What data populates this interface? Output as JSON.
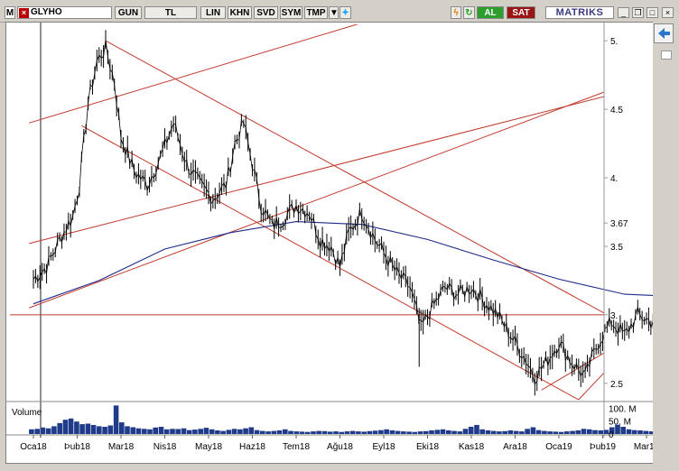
{
  "toolbar": {
    "menu_label": "M",
    "symbol": "GLYHO",
    "buttons": [
      "GUN",
      "TL",
      "LIN",
      "KHN",
      "SVD",
      "SYM",
      "TMP"
    ],
    "buy_label": "AL",
    "sell_label": "SAT",
    "brand": "MATRIKS"
  },
  "chart_data": {
    "type": "line",
    "title": "",
    "y_ticks": [
      "5.",
      "4.5",
      "4.",
      "3.67",
      "3.5",
      "3.",
      "2.5"
    ],
    "y_tick_values": [
      5.0,
      4.5,
      4.0,
      3.67,
      3.5,
      3.0,
      2.5
    ],
    "last_price": 3.67,
    "x_labels": [
      "Oca18",
      "Þub18",
      "Mar18",
      "Nis18",
      "May18",
      "Haz18",
      "Tem18",
      "Ağu18",
      "Eyl18",
      "Eki18",
      "Kas18",
      "Ara18",
      "Oca19",
      "Þub19",
      "Mar19"
    ],
    "price_path": [
      [
        0,
        3.26
      ],
      [
        0.3,
        3.35
      ],
      [
        0.6,
        3.55
      ],
      [
        0.9,
        3.72
      ],
      [
        1.05,
        3.95
      ],
      [
        1.25,
        4.55
      ],
      [
        1.45,
        4.85
      ],
      [
        1.65,
        4.95
      ],
      [
        1.85,
        4.7
      ],
      [
        2.0,
        4.3
      ],
      [
        2.3,
        4.05
      ],
      [
        2.6,
        3.95
      ],
      [
        2.9,
        4.15
      ],
      [
        3.2,
        4.4
      ],
      [
        3.5,
        4.1
      ],
      [
        3.8,
        3.95
      ],
      [
        4.1,
        3.85
      ],
      [
        4.4,
        3.95
      ],
      [
        4.6,
        4.25
      ],
      [
        4.8,
        4.4
      ],
      [
        5.0,
        4.1
      ],
      [
        5.2,
        3.8
      ],
      [
        5.45,
        3.65
      ],
      [
        5.7,
        3.7
      ],
      [
        6.0,
        3.8
      ],
      [
        6.3,
        3.75
      ],
      [
        6.55,
        3.55
      ],
      [
        6.8,
        3.5
      ],
      [
        7.0,
        3.35
      ],
      [
        7.2,
        3.6
      ],
      [
        7.5,
        3.75
      ],
      [
        7.8,
        3.55
      ],
      [
        8.0,
        3.45
      ],
      [
        8.3,
        3.3
      ],
      [
        8.6,
        3.2
      ],
      [
        8.85,
        2.9
      ],
      [
        9.1,
        3.05
      ],
      [
        9.4,
        3.2
      ],
      [
        9.7,
        3.15
      ],
      [
        10.0,
        3.2
      ],
      [
        10.3,
        3.1
      ],
      [
        10.6,
        3.0
      ],
      [
        10.9,
        2.85
      ],
      [
        11.2,
        2.7
      ],
      [
        11.45,
        2.55
      ],
      [
        11.7,
        2.65
      ],
      [
        12.0,
        2.8
      ],
      [
        12.3,
        2.65
      ],
      [
        12.6,
        2.55
      ],
      [
        12.9,
        2.8
      ],
      [
        13.2,
        2.95
      ],
      [
        13.5,
        2.85
      ],
      [
        13.8,
        3.0
      ],
      [
        14.1,
        2.95
      ],
      [
        14.4,
        3.05
      ],
      [
        14.7,
        3.0
      ],
      [
        15.0,
        3.15
      ],
      [
        15.3,
        3.35
      ],
      [
        15.6,
        3.5
      ],
      [
        15.9,
        3.55
      ],
      [
        16.2,
        3.7
      ],
      [
        16.5,
        3.8
      ],
      [
        16.8,
        3.75
      ],
      [
        17.0,
        3.82
      ],
      [
        17.2,
        3.7
      ],
      [
        17.4,
        3.67
      ]
    ],
    "moving_average": [
      [
        0,
        3.08
      ],
      [
        1.5,
        3.25
      ],
      [
        3,
        3.48
      ],
      [
        4.5,
        3.6
      ],
      [
        6,
        3.68
      ],
      [
        7.5,
        3.66
      ],
      [
        9,
        3.55
      ],
      [
        10.5,
        3.4
      ],
      [
        12,
        3.26
      ],
      [
        13.5,
        3.15
      ],
      [
        15,
        3.13
      ],
      [
        16.5,
        3.2
      ],
      [
        17.4,
        3.28
      ]
    ],
    "trend_lines": [
      [
        [
          -0.1,
          4.4
        ],
        [
          7.7,
          5.15
        ]
      ],
      [
        [
          -0.1,
          3.52
        ],
        [
          17.4,
          4.95
        ]
      ],
      [
        [
          -0.1,
          3.05
        ],
        [
          17.4,
          5.15
        ]
      ],
      [
        [
          1.65,
          5.0
        ],
        [
          17.4,
          2.25
        ]
      ],
      [
        [
          1.1,
          4.38
        ],
        [
          12.9,
          2.3
        ]
      ],
      [
        [
          12.3,
          2.33
        ],
        [
          17.4,
          4.05
        ]
      ],
      [
        [
          11.6,
          2.45
        ],
        [
          17.4,
          3.55
        ]
      ]
    ],
    "support_level": 3.0,
    "volume": {
      "label": "Volume",
      "ticks": [
        "100. M",
        "50. M",
        "0"
      ],
      "tick_values": [
        100,
        50,
        0
      ],
      "values": [
        18,
        20,
        25,
        22,
        30,
        42,
        55,
        60,
        48,
        38,
        40,
        35,
        30,
        28,
        33,
        110,
        45,
        30,
        26,
        22,
        20,
        18,
        25,
        28,
        18,
        20,
        19,
        22,
        15,
        17,
        20,
        24,
        18,
        14,
        12,
        16,
        20,
        18,
        22,
        26,
        15,
        12,
        10,
        12,
        14,
        18,
        12,
        10,
        9,
        8,
        10,
        12,
        11,
        9,
        10,
        8,
        10,
        12,
        10,
        9,
        11,
        13,
        15,
        18,
        14,
        12,
        10,
        9,
        8,
        10,
        11,
        14,
        16,
        18,
        14,
        12,
        10,
        20,
        28,
        35,
        18,
        14,
        12,
        10,
        11,
        14,
        12,
        10,
        20,
        26,
        15,
        12,
        10,
        9,
        8,
        10,
        12,
        14,
        20,
        18,
        15,
        14,
        16,
        26,
        36,
        28,
        18,
        15,
        14,
        12,
        10,
        11,
        10,
        9,
        12,
        14,
        18,
        20,
        22,
        25,
        24,
        22,
        20,
        18,
        16,
        14,
        15,
        18,
        22,
        25,
        20,
        16,
        14,
        12,
        10,
        9
      ]
    }
  }
}
